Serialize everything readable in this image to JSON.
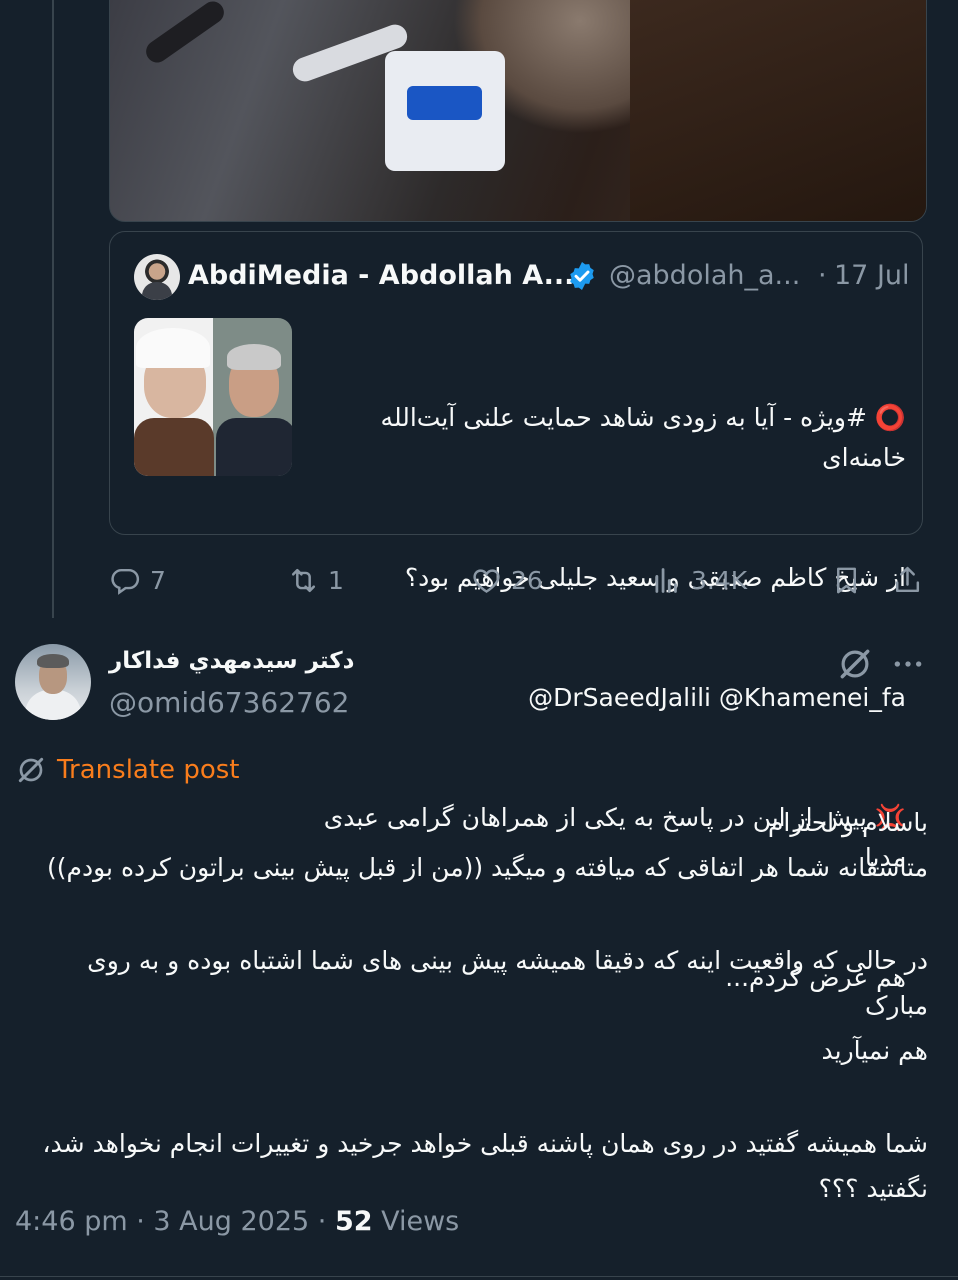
{
  "quoted": {
    "author_name": "AbdiMedia - Abdollah A...",
    "handle": "@abdolah_a...",
    "separator": "·",
    "date": "17 Jul",
    "text_line1": "⭕ #ویژه - آیا به زودی شاهد حمایت علنی آیت‌الله خامنه‌ای",
    "text_line2": "از شیخ کاظم صدیقی و سعید جلیلی خواهیم بود؟",
    "text_line3": "@DrSaeedJalili @Khamenei_fa",
    "text_line4": "💢 پیش از این در پاسخ به یکی از همراهان گرامی عبدی مدیا",
    "text_line5": "هم عرض کردم..."
  },
  "actions": {
    "replies": "7",
    "reposts": "1",
    "likes": "26",
    "views": "3.4K"
  },
  "reply": {
    "author_name": "دكتر سيدمهدي فداكار",
    "handle": "@omid67362762",
    "translate_label": "Translate post",
    "paragraph1_line1": "باسلام و احترام",
    "paragraph1_line2": "متاسفانه شما هر اتفاقی که میافته و میگید ((من از قبل پیش بینی براتون کرده بودم))",
    "paragraph2_line1": "در حالی که واقعیت اینه که دقیقا همیشه پیش بینی های شما اشتباه بوده و به روی مبارک",
    "paragraph2_line2": "هم نمیآرید",
    "paragraph3_line1": "شما همیشه گفتید در روی همان پاشنه قبلی خواهد جرخید و تغییرات انجام نخواهد شد،",
    "paragraph3_line2": "نگفتید ؟؟؟",
    "timestamp": "4:46 pm · 3 Aug 2025 · ",
    "views_count": "52",
    "views_label": " Views"
  },
  "colors": {
    "background": "#15202b",
    "muted": "#8b98a5",
    "accent_blue": "#1d9bf0",
    "translate_orange": "#f97d1c"
  }
}
